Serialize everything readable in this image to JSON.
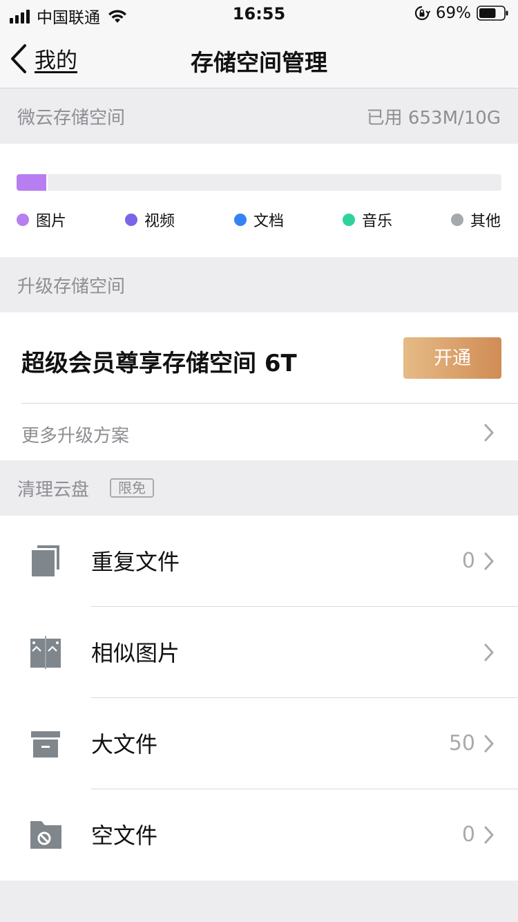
{
  "status_bar": {
    "carrier": "中国联通",
    "time": "16:55",
    "battery": "69%",
    "battery_level": 0.69
  },
  "nav": {
    "back_label": "我的",
    "title": "存储空间管理"
  },
  "storage": {
    "section_label": "微云存储空间",
    "usage_text": "已用 653M/10G",
    "used_fraction": 0.0638,
    "legend": [
      {
        "label": "图片",
        "color": "#b77ef1"
      },
      {
        "label": "视频",
        "color": "#7b64e6"
      },
      {
        "label": "文档",
        "color": "#3583f3"
      },
      {
        "label": "音乐",
        "color": "#2ed39b"
      },
      {
        "label": "其他",
        "color": "#a5a9ad"
      }
    ]
  },
  "upgrade": {
    "section_label": "升级存储空间",
    "vip_text": "超级会员尊享存储空间 6T",
    "open_button": "开通",
    "more_plans": "更多升级方案"
  },
  "clean": {
    "section_label": "清理云盘",
    "badge": "限免",
    "items": [
      {
        "label": "重复文件",
        "count": "0",
        "icon": "duplicate-files-icon"
      },
      {
        "label": "相似图片",
        "count": "",
        "icon": "similar-images-icon"
      },
      {
        "label": "大文件",
        "count": "50",
        "icon": "archive-box-icon"
      },
      {
        "label": "空文件",
        "count": "0",
        "icon": "empty-folder-icon"
      }
    ]
  },
  "colors": {
    "accent_gold_start": "#e6bb86",
    "accent_gold_end": "#d08c55",
    "icon_gray": "#7f878d"
  }
}
